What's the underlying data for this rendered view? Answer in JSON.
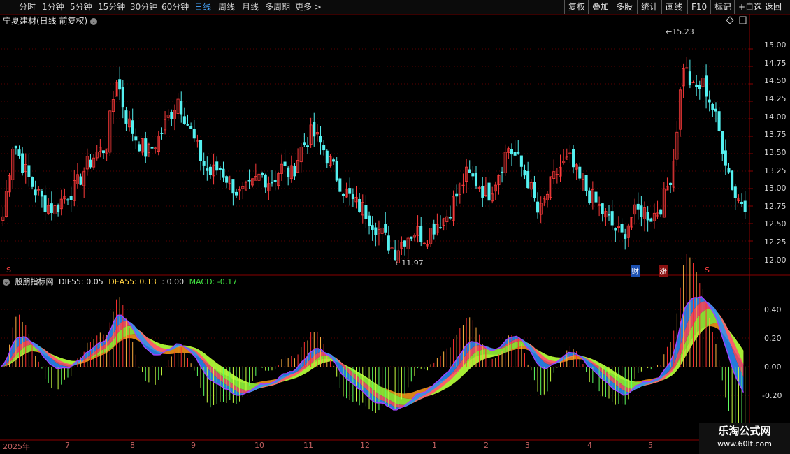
{
  "toolbar": {
    "periods": [
      "分时",
      "1分钟",
      "5分钟",
      "15分钟",
      "30分钟",
      "60分钟",
      "日线",
      "周线",
      "月线",
      "多周期",
      "更多 >"
    ],
    "active_period": "日线",
    "right_buttons": [
      "复权",
      "叠加",
      "多股",
      "统计",
      "画线",
      "F10",
      "标记",
      "+自选",
      "返回"
    ]
  },
  "main": {
    "title": "宁夏建材(日线 前复权)",
    "high_label": "15.23",
    "low_label": "11.97",
    "price_ticks": [
      "15.00",
      "14.75",
      "14.50",
      "14.25",
      "14.00",
      "13.75",
      "13.50",
      "13.25",
      "13.00",
      "12.75",
      "12.50",
      "12.25",
      "12.00"
    ],
    "markers": {
      "cai": "财",
      "zhang": "涨",
      "s1": "S",
      "s2": "S"
    }
  },
  "indicator": {
    "name": "股朋指标网",
    "dif_label": "DIF55: 0.05",
    "dea_label": "DEA55: 0.13",
    "zero_label": ": 0.00",
    "macd_label": "MACD: -0.17",
    "ticks": [
      "0.40",
      "0.20",
      "0.00",
      "-0.20"
    ]
  },
  "xaxis": {
    "labels": [
      "2025年",
      "7",
      "8",
      "9",
      "10",
      "11",
      "12",
      "1",
      "2",
      "3",
      "4",
      "5"
    ]
  },
  "logo": {
    "line1": "乐淘公式网",
    "line2": "www.60lt.com"
  },
  "colors": {
    "up": "#ff3b3b",
    "down": "#54f0f0",
    "grid": "#5a0000",
    "accent": "#4aa8ff"
  },
  "chart_data": {
    "type": "candlestick",
    "ylim": [
      11.9,
      15.3
    ],
    "high": 15.23,
    "low": 11.97,
    "closes": [
      12.6,
      13.7,
      13.3,
      13.0,
      12.8,
      12.7,
      12.9,
      13.0,
      13.3,
      13.5,
      13.6,
      14.6,
      14.0,
      13.7,
      13.5,
      13.7,
      14.0,
      14.3,
      13.9,
      13.5,
      13.2,
      13.3,
      13.1,
      12.9,
      13.0,
      13.2,
      13.1,
      13.3,
      13.2,
      13.6,
      13.8,
      13.6,
      13.3,
      13.0,
      12.8,
      12.7,
      12.5,
      12.3,
      12.1,
      12.3,
      12.4,
      12.3,
      12.5,
      12.6,
      12.9,
      13.2,
      13.1,
      12.9,
      13.2,
      13.6,
      13.4,
      13.1,
      12.6,
      13.0,
      13.3,
      13.4,
      13.1,
      12.9,
      12.7,
      12.5,
      12.3,
      12.6,
      12.7,
      12.6,
      12.8,
      13.3,
      14.8,
      14.4,
      14.5,
      14.1,
      13.5,
      12.9,
      12.8
    ]
  }
}
